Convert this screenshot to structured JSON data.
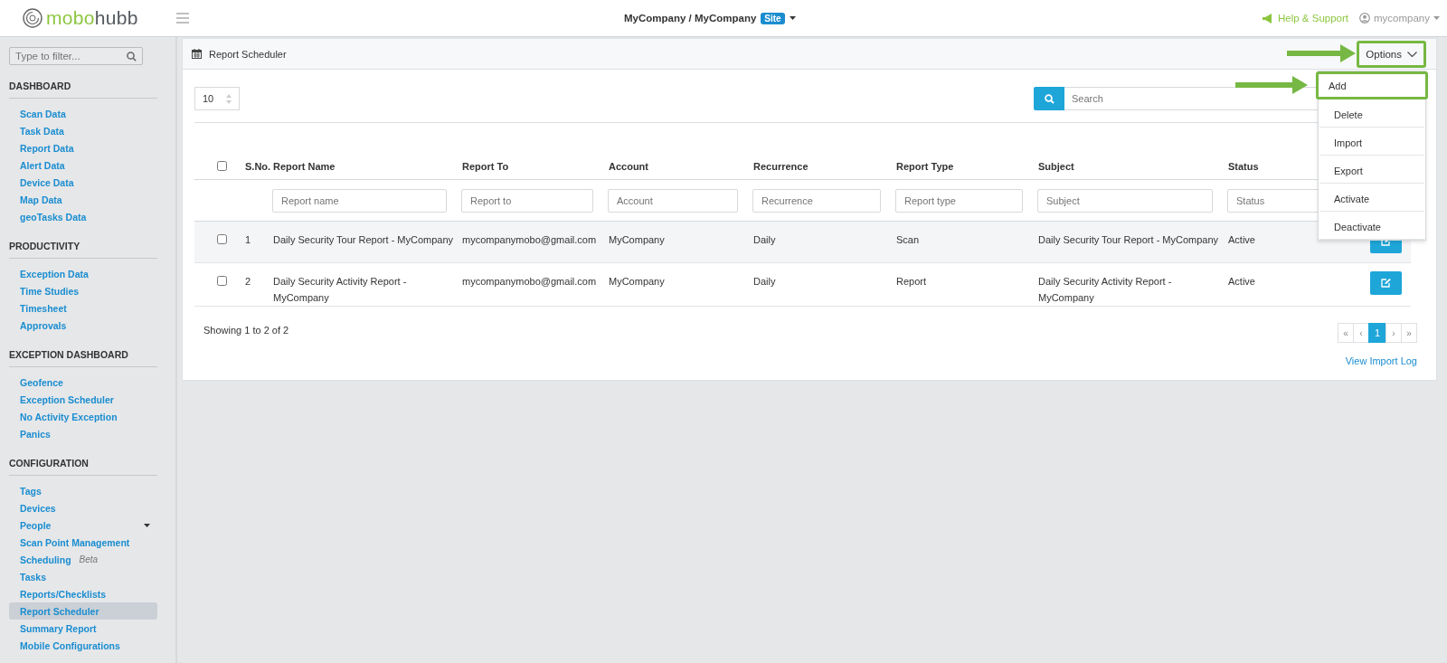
{
  "topbar": {
    "logo": {
      "part_1": "mobo",
      "part_2": "hubb"
    },
    "site_path": "MyCompany / MyCompany",
    "site_badge": "Site",
    "help_link": "Help & Support",
    "user": "mycompany"
  },
  "sidebar": {
    "filter": {
      "placeholder": "Type to filter..."
    },
    "sections": [
      {
        "title": "DASHBOARD",
        "items": [
          {
            "label": "Scan Data",
            "selected": false
          },
          {
            "label": "Task Data",
            "selected": false
          },
          {
            "label": "Report Data",
            "selected": false
          },
          {
            "label": "Alert Data",
            "selected": false
          },
          {
            "label": "Device Data",
            "selected": false
          },
          {
            "label": "Map Data",
            "selected": false
          },
          {
            "label": "geoTasks Data",
            "selected": false
          }
        ]
      },
      {
        "title": "PRODUCTIVITY",
        "items": [
          {
            "label": "Exception Data",
            "selected": false
          },
          {
            "label": "Time Studies",
            "selected": false
          },
          {
            "label": "Timesheet",
            "selected": false
          },
          {
            "label": "Approvals",
            "selected": false
          }
        ]
      },
      {
        "title": "EXCEPTION DASHBOARD",
        "items": [
          {
            "label": "Geofence",
            "selected": false
          },
          {
            "label": "Exception Scheduler",
            "selected": false
          },
          {
            "label": "No Activity Exception",
            "selected": false
          },
          {
            "label": "Panics",
            "selected": false
          }
        ]
      },
      {
        "title": "CONFIGURATION",
        "items": [
          {
            "label": "Tags",
            "selected": false
          },
          {
            "label": "Devices",
            "selected": false
          },
          {
            "label": "People",
            "selected": false,
            "expandable": true
          },
          {
            "label": "Scan Point Management",
            "selected": false
          },
          {
            "label": "Scheduling",
            "selected": false,
            "badge": "Beta"
          },
          {
            "label": "Tasks",
            "selected": false
          },
          {
            "label": "Reports/Checklists",
            "selected": false
          },
          {
            "label": "Report Scheduler",
            "selected": true
          },
          {
            "label": "Summary Report",
            "selected": false
          },
          {
            "label": "Mobile Configurations",
            "selected": false
          }
        ]
      }
    ]
  },
  "page": {
    "title": "Report Scheduler",
    "options": {
      "label": "Options",
      "expanded": true,
      "highlighted": true,
      "menu": [
        {
          "label": "Add",
          "highlighted": true
        },
        {
          "label": "Delete",
          "highlighted": false
        },
        {
          "label": "Import",
          "highlighted": false
        },
        {
          "label": "Export",
          "highlighted": false
        },
        {
          "label": "Activate",
          "highlighted": false
        },
        {
          "label": "Deactivate",
          "highlighted": false
        }
      ]
    },
    "page_length": "10",
    "search": {
      "placeholder": "Search"
    },
    "table": {
      "select_all_checked": false,
      "columns": [
        "S.No.",
        "Report Name",
        "Report To",
        "Account",
        "Recurrence",
        "Report Type",
        "Subject",
        "Status"
      ],
      "filters": [
        {
          "placeholder": "Report name"
        },
        {
          "placeholder": "Report to"
        },
        {
          "placeholder": "Account"
        },
        {
          "placeholder": "Recurrence"
        },
        {
          "placeholder": "Report type"
        },
        {
          "placeholder": "Subject"
        },
        {
          "placeholder": "Status"
        }
      ],
      "rows": [
        {
          "checked": false,
          "cells": [
            "1",
            "Daily Security Tour Report - MyCompany",
            "mycompanymobo@gmail.com",
            "MyCompany",
            "Daily",
            "Scan",
            "Daily Security Tour Report - MyCompany",
            "Active"
          ]
        },
        {
          "checked": false,
          "cells": [
            "2",
            "Daily Security Activity Report - MyCompany",
            "mycompanymobo@gmail.com",
            "MyCompany",
            "Daily",
            "Report",
            "Daily Security Activity Report - MyCompany",
            "Active"
          ]
        }
      ]
    },
    "info": "Showing 1 to 2 of 2",
    "pagination": [
      {
        "label": "«",
        "selected": false
      },
      {
        "label": "‹",
        "selected": false
      },
      {
        "label": "1",
        "selected": true
      },
      {
        "label": "›",
        "selected": false
      },
      {
        "label": "»",
        "selected": false
      }
    ],
    "import_log_link": "View Import Log"
  }
}
